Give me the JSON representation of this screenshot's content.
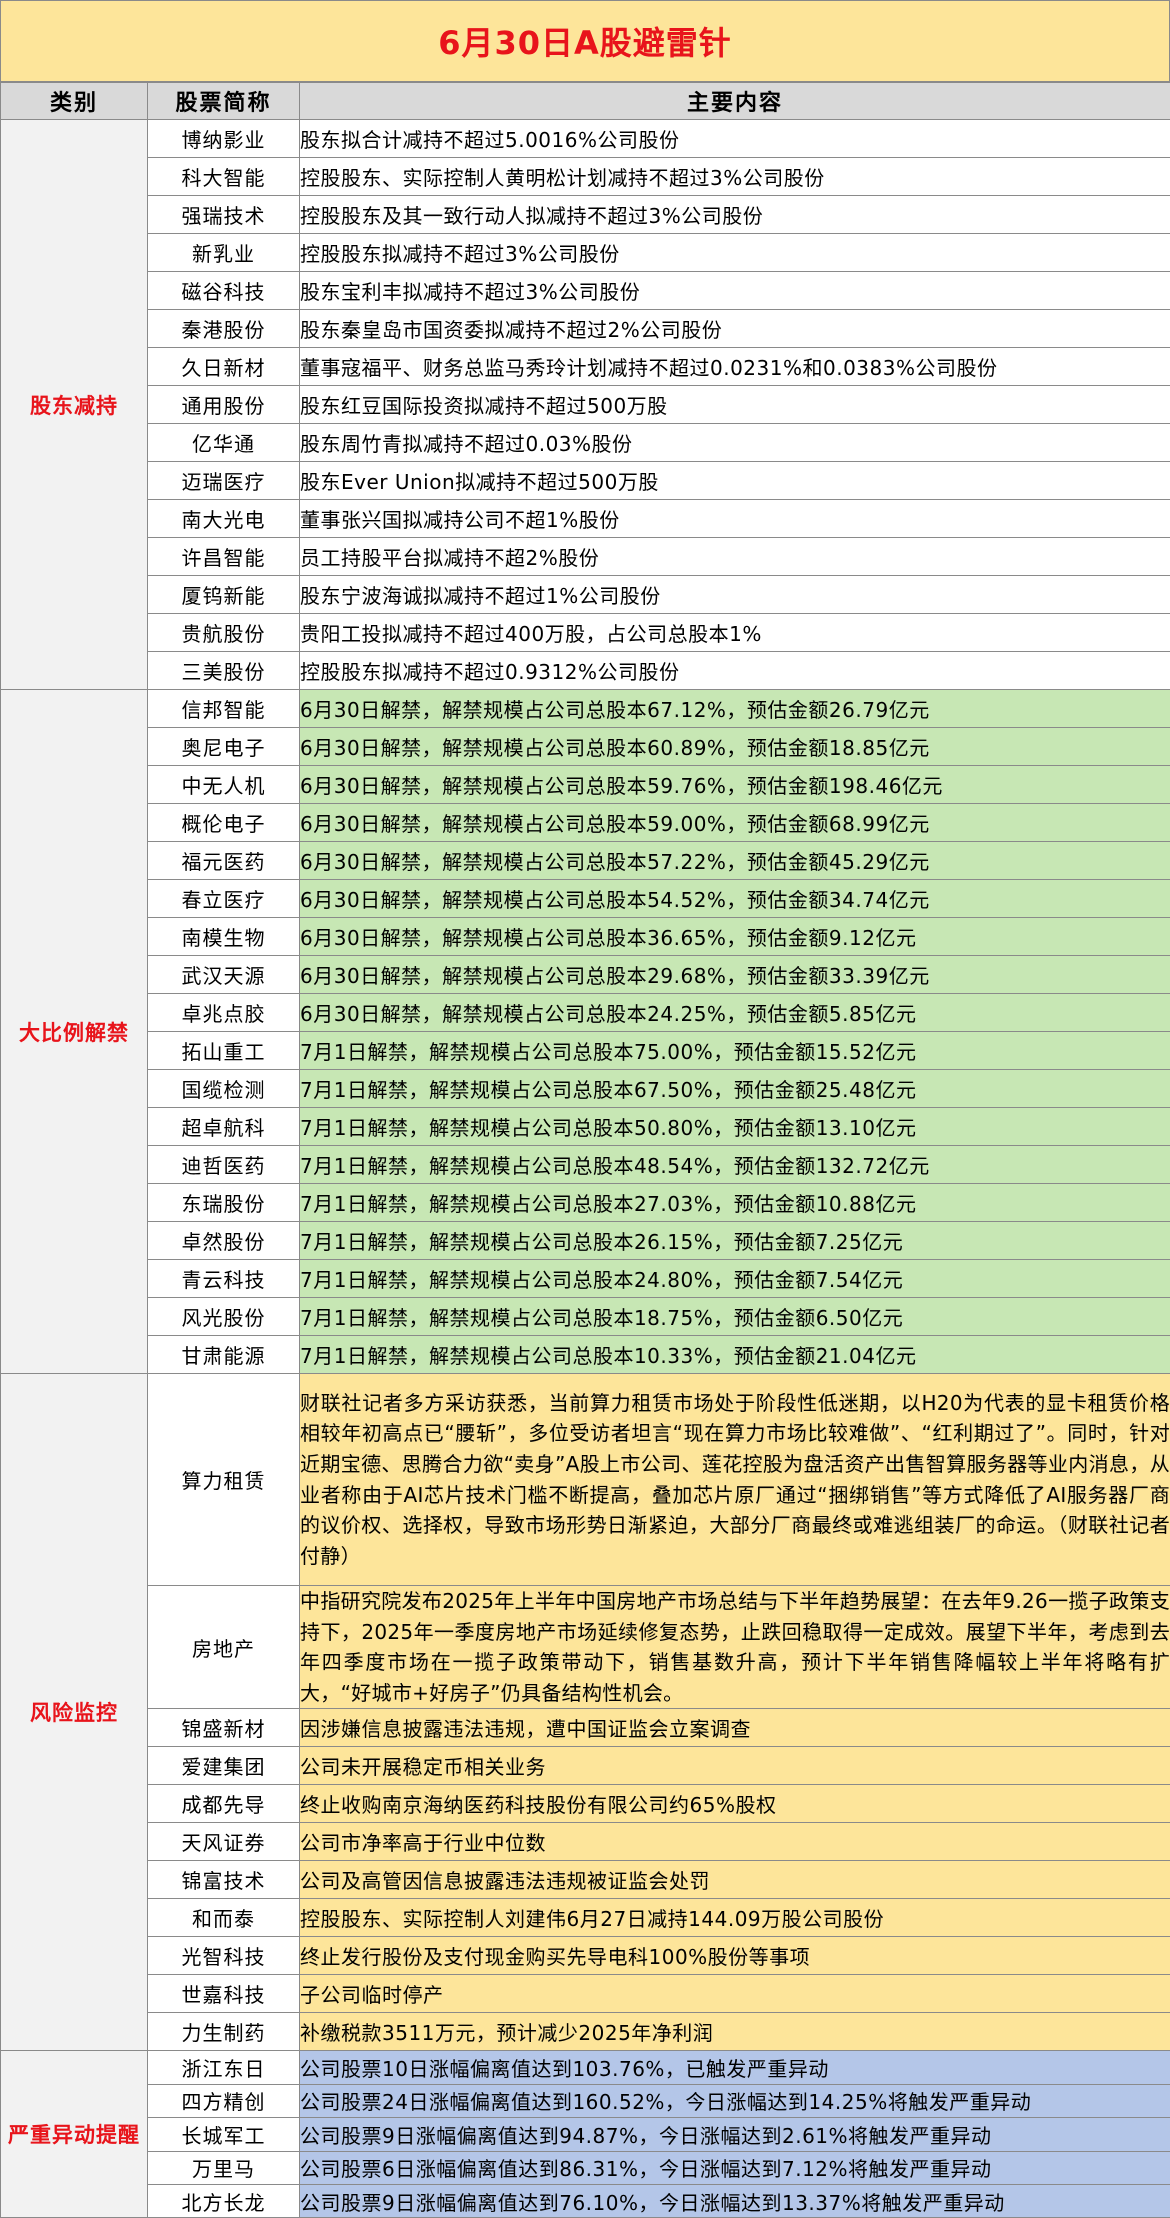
{
  "title": "6月30日A股避雷针",
  "headers": {
    "category": "类别",
    "stock": "股票简称",
    "content": "主要内容"
  },
  "colors": {
    "title_bg": "#fde59a",
    "title_text": "#e8141b",
    "category_text": "#e8141b",
    "unlock_bg": "#c7e7b4",
    "risk_bg": "#fde59a",
    "alert_bg": "#b4c6e8"
  },
  "groups": {
    "holdings": {
      "category": "股东减持",
      "rows": [
        {
          "name": "博纳影业",
          "content": "股东拟合计减持不超过5.0016%公司股份"
        },
        {
          "name": "科大智能",
          "content": "控股股东、实际控制人黄明松计划减持不超过3%公司股份"
        },
        {
          "name": "强瑞技术",
          "content": "控股股东及其一致行动人拟减持不超过3%公司股份"
        },
        {
          "name": "新乳业",
          "content": "控股股东拟减持不超过3%公司股份"
        },
        {
          "name": "磁谷科技",
          "content": "股东宝利丰拟减持不超过3%公司股份"
        },
        {
          "name": "秦港股份",
          "content": "股东秦皇岛市国资委拟减持不超过2%公司股份"
        },
        {
          "name": "久日新材",
          "content": "董事寇福平、财务总监马秀玲计划减持不超过0.0231%和0.0383%公司股份"
        },
        {
          "name": "通用股份",
          "content": "股东红豆国际投资拟减持不超过500万股"
        },
        {
          "name": "亿华通",
          "content": "股东周竹青拟减持不超过0.03%股份"
        },
        {
          "name": "迈瑞医疗",
          "content": "股东Ever Union拟减持不超过500万股"
        },
        {
          "name": "南大光电",
          "content": "董事张兴国拟减持公司不超1%股份"
        },
        {
          "name": "许昌智能",
          "content": "员工持股平台拟减持不超2%股份"
        },
        {
          "name": "厦钨新能",
          "content": "股东宁波海诚拟减持不超过1%公司股份"
        },
        {
          "name": "贵航股份",
          "content": "贵阳工投拟减持不超过400万股，占公司总股本1%"
        },
        {
          "name": "三美股份",
          "content": "控股股东拟减持不超过0.9312%公司股份"
        }
      ]
    },
    "unlock": {
      "category": "大比例解禁",
      "rows": [
        {
          "name": "信邦智能",
          "content": "6月30日解禁，解禁规模占公司总股本67.12%，预估金额26.79亿元"
        },
        {
          "name": "奥尼电子",
          "content": "6月30日解禁，解禁规模占公司总股本60.89%，预估金额18.85亿元"
        },
        {
          "name": "中无人机",
          "content": "6月30日解禁，解禁规模占公司总股本59.76%，预估金额198.46亿元"
        },
        {
          "name": "概伦电子",
          "content": "6月30日解禁，解禁规模占公司总股本59.00%，预估金额68.99亿元"
        },
        {
          "name": "福元医药",
          "content": "6月30日解禁，解禁规模占公司总股本57.22%，预估金额45.29亿元"
        },
        {
          "name": "春立医疗",
          "content": "6月30日解禁，解禁规模占公司总股本54.52%，预估金额34.74亿元"
        },
        {
          "name": "南模生物",
          "content": "6月30日解禁，解禁规模占公司总股本36.65%，预估金额9.12亿元"
        },
        {
          "name": "武汉天源",
          "content": "6月30日解禁，解禁规模占公司总股本29.68%，预估金额33.39亿元"
        },
        {
          "name": "卓兆点胶",
          "content": "6月30日解禁，解禁规模占公司总股本24.25%，预估金额5.85亿元"
        },
        {
          "name": "拓山重工",
          "content": "7月1日解禁，解禁规模占公司总股本75.00%，预估金额15.52亿元"
        },
        {
          "name": "国缆检测",
          "content": "7月1日解禁，解禁规模占公司总股本67.50%，预估金额25.48亿元"
        },
        {
          "name": "超卓航科",
          "content": "7月1日解禁，解禁规模占公司总股本50.80%，预估金额13.10亿元"
        },
        {
          "name": "迪哲医药",
          "content": "7月1日解禁，解禁规模占公司总股本48.54%，预估金额132.72亿元"
        },
        {
          "name": "东瑞股份",
          "content": "7月1日解禁，解禁规模占公司总股本27.03%，预估金额10.88亿元"
        },
        {
          "name": "卓然股份",
          "content": "7月1日解禁，解禁规模占公司总股本26.15%，预估金额7.25亿元"
        },
        {
          "name": "青云科技",
          "content": "7月1日解禁，解禁规模占公司总股本24.80%，预估金额7.54亿元"
        },
        {
          "name": "风光股份",
          "content": "7月1日解禁，解禁规模占公司总股本18.75%，预估金额6.50亿元"
        },
        {
          "name": "甘肃能源",
          "content": "7月1日解禁，解禁规模占公司总股本10.33%，预估金额21.04亿元"
        }
      ]
    },
    "risk": {
      "category": "风险监控",
      "rows": [
        {
          "name": "算力租赁",
          "content": "财联社记者多方采访获悉，当前算力租赁市场处于阶段性低迷期，以H20为代表的显卡租赁价格相较年初高点已“腰斩”，多位受访者坦言“现在算力市场比较难做”、“红利期过了”。同时，针对近期宝德、思腾合力欲“卖身”A股上市公司、莲花控股为盘活资产出售智算服务器等业内消息，从业者称由于AI芯片技术门槛不断提高，叠加芯片原厂通过“捆绑销售”等方式降低了AI服务器厂商的议价权、选择权，导致市场形势日渐紧迫，大部分厂商最终或难逃组装厂的命运。（财联社记者 付静）"
        },
        {
          "name": "房地产",
          "content": "中指研究院发布2025年上半年中国房地产市场总结与下半年趋势展望：在去年9.26一揽子政策支持下，2025年一季度房地产市场延续修复态势，止跌回稳取得一定成效。展望下半年，考虑到去年四季度市场在一揽子政策带动下，销售基数升高，预计下半年销售降幅较上半年将略有扩大，“好城市+好房子”仍具备结构性机会。"
        },
        {
          "name": "锦盛新材",
          "content": "因涉嫌信息披露违法违规，遭中国证监会立案调查"
        },
        {
          "name": "爱建集团",
          "content": "公司未开展稳定币相关业务"
        },
        {
          "name": "成都先导",
          "content": "终止收购南京海纳医药科技股份有限公司约65%股权"
        },
        {
          "name": "天风证券",
          "content": "公司市净率高于行业中位数"
        },
        {
          "name": "锦富技术",
          "content": "公司及高管因信息披露违法违规被证监会处罚"
        },
        {
          "name": "和而泰",
          "content": "控股股东、实际控制人刘建伟6月27日减持144.09万股公司股份"
        },
        {
          "name": "光智科技",
          "content": "终止发行股份及支付现金购买先导电科100%股份等事项"
        },
        {
          "name": "世嘉科技",
          "content": "子公司临时停产"
        },
        {
          "name": "力生制药",
          "content": "补缴税款3511万元，预计减少2025年净利润"
        }
      ]
    },
    "alert": {
      "category": "严重异动提醒",
      "rows": [
        {
          "name": "浙江东日",
          "content": "公司股票10日涨幅偏离值达到103.76%，已触发严重异动"
        },
        {
          "name": "四方精创",
          "content": "公司股票24日涨幅偏离值达到160.52%，今日涨幅达到14.25%将触发严重异动"
        },
        {
          "name": "长城军工",
          "content": "公司股票9日涨幅偏离值达到94.87%，今日涨幅达到2.61%将触发严重异动"
        },
        {
          "name": "万里马",
          "content": "公司股票6日涨幅偏离值达到86.31%，今日涨幅达到7.12%将触发严重异动"
        },
        {
          "name": "北方长龙",
          "content": "公司股票9日涨幅偏离值达到76.10%，今日涨幅达到13.37%将触发严重异动"
        }
      ]
    }
  }
}
